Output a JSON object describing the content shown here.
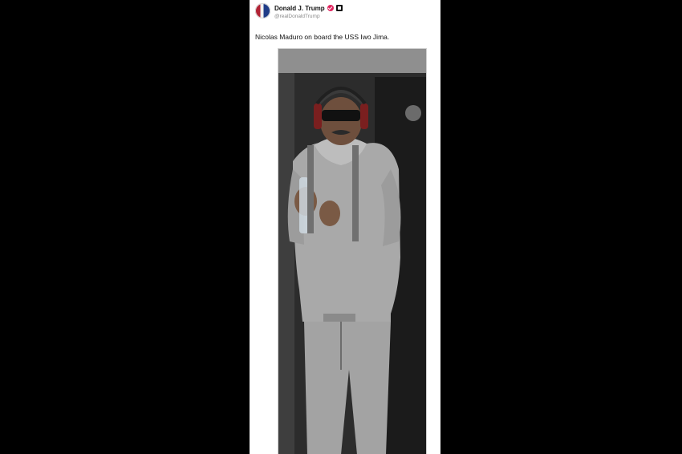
{
  "post": {
    "display_name": "Donald J. Trump",
    "handle": "@realDonaldTrump",
    "text": "Nicolas Maduro on board the USS Iwo Jima.",
    "icons": {
      "avatar": "avatar-photo",
      "verified": "verified-badge-icon",
      "affiliation": "affiliation-badge-icon"
    },
    "media": {
      "type": "photo"
    }
  },
  "colors": {
    "background": "#000000",
    "card": "#ffffff",
    "verified": "#e0245e",
    "handle": "#8a8a8a"
  }
}
